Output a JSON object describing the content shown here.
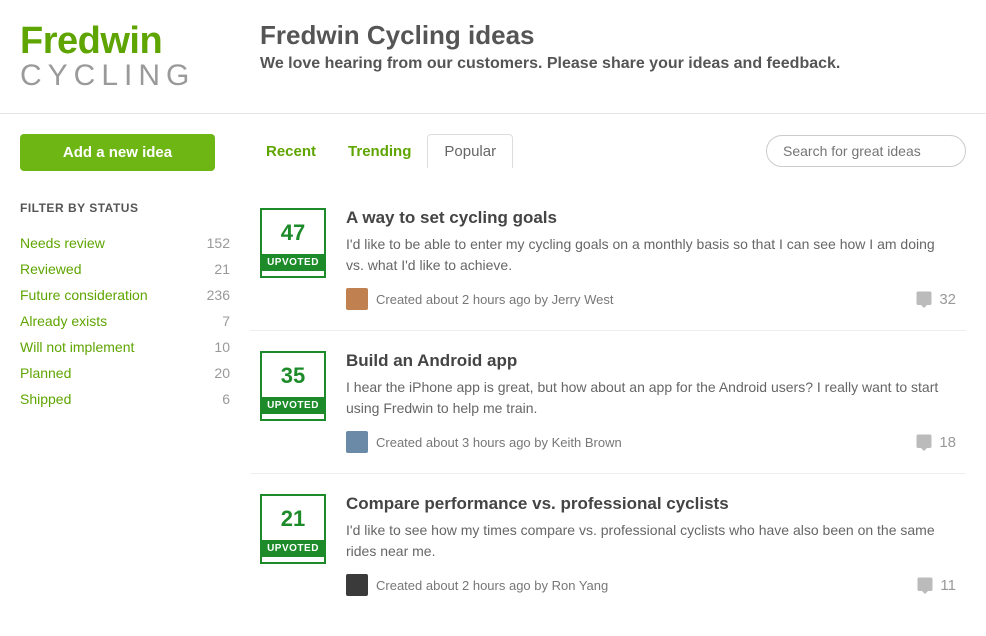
{
  "logo": {
    "line1": "Fredwin",
    "line2": "CYCLING"
  },
  "header": {
    "title": "Fredwin Cycling ideas",
    "subtitle": "We love hearing from our customers. Please share your ideas and feedback."
  },
  "sidebar": {
    "addButton": "Add a new idea",
    "filterTitle": "FILTER BY STATUS",
    "filters": [
      {
        "name": "Needs review",
        "count": "152"
      },
      {
        "name": "Reviewed",
        "count": "21"
      },
      {
        "name": "Future consideration",
        "count": "236"
      },
      {
        "name": "Already exists",
        "count": "7"
      },
      {
        "name": "Will not implement",
        "count": "10"
      },
      {
        "name": "Planned",
        "count": "20"
      },
      {
        "name": "Shipped",
        "count": "6"
      }
    ]
  },
  "tabs": {
    "recent": "Recent",
    "trending": "Trending",
    "popular": "Popular",
    "searchPlaceholder": "Search for great ideas"
  },
  "ideas": [
    {
      "votes": "47",
      "upvoteLabel": "UPVOTED",
      "title": "A way to set cycling goals",
      "desc": "I'd like to be able to enter my cycling goals on a monthly basis so that I can see how I am doing vs. what I'd like to achieve.",
      "meta": "Created about 2 hours ago by Jerry West",
      "comments": "32",
      "avatarColor": "#c08050"
    },
    {
      "votes": "35",
      "upvoteLabel": "UPVOTED",
      "title": "Build an Android app",
      "desc": "I hear the iPhone app is great, but how about an app for the Android users? I really want to start using Fredwin to help me train.",
      "meta": "Created about 3 hours ago by Keith Brown",
      "comments": "18",
      "avatarColor": "#6a8aa8"
    },
    {
      "votes": "21",
      "upvoteLabel": "UPVOTED",
      "title": "Compare performance vs. professional cyclists",
      "desc": "I'd like to see how my times compare vs. professional cyclists who have also been on the same rides near me.",
      "meta": "Created about 2 hours ago by Ron Yang",
      "comments": "11",
      "avatarColor": "#3a3a3a"
    }
  ]
}
